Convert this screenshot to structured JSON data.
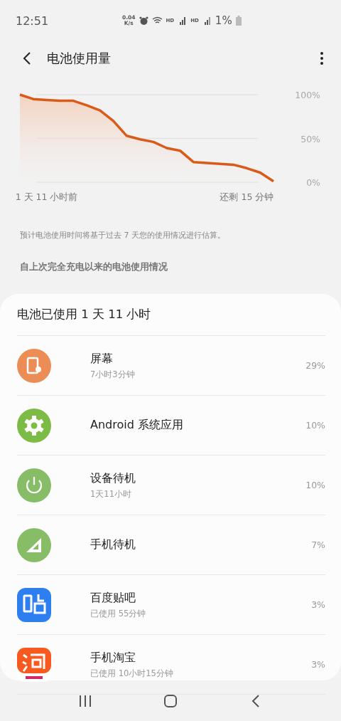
{
  "status_bar": {
    "time": "12:51",
    "speed_value": "0.04",
    "speed_unit": "K/s",
    "sim1": "HD",
    "sim2": "HD",
    "battery": "1%"
  },
  "header": {
    "title": "电池使用量"
  },
  "chart_data": {
    "type": "area",
    "categories": [
      null,
      null,
      "1 天 11 小时前",
      null,
      null,
      null,
      null,
      null,
      null,
      null,
      null,
      null,
      null,
      null,
      null,
      null,
      null,
      "还剩 15 分钟",
      null,
      null
    ],
    "values": [
      100,
      95,
      94,
      93,
      93,
      88,
      82,
      70,
      53,
      49,
      46,
      39,
      36,
      23,
      22,
      21,
      20,
      16,
      11,
      1
    ],
    "ylim": [
      0,
      100
    ],
    "yticks": [
      {
        "value": 0,
        "label": "0%"
      },
      {
        "value": 50,
        "label": "50%"
      },
      {
        "value": 100,
        "label": "100%"
      }
    ]
  },
  "note": "预计电池使用时间将基于过去 7 天您的使用情况进行估算。",
  "section_title": "自上次完全充电以来的电池使用情况",
  "usage": {
    "summary": "电池已使用 1 天 11 小时",
    "items": [
      {
        "kind": "screen",
        "name": "屏幕",
        "detail": "7小时3分钟",
        "percent": "29%"
      },
      {
        "kind": "gear",
        "name": "Android 系统应用",
        "percent": "10%"
      },
      {
        "kind": "power",
        "name": "设备待机",
        "detail": "1天11小时",
        "percent": "10%"
      },
      {
        "kind": "signal",
        "name": "手机待机",
        "percent": "7%"
      },
      {
        "kind": "app-blue",
        "name": "百度贴吧",
        "detail": "已使用 55分钟",
        "percent": "3%"
      },
      {
        "kind": "app-orange",
        "name": "手机淘宝",
        "detail": "已使用 10小时15分钟",
        "percent": "3%"
      }
    ]
  }
}
